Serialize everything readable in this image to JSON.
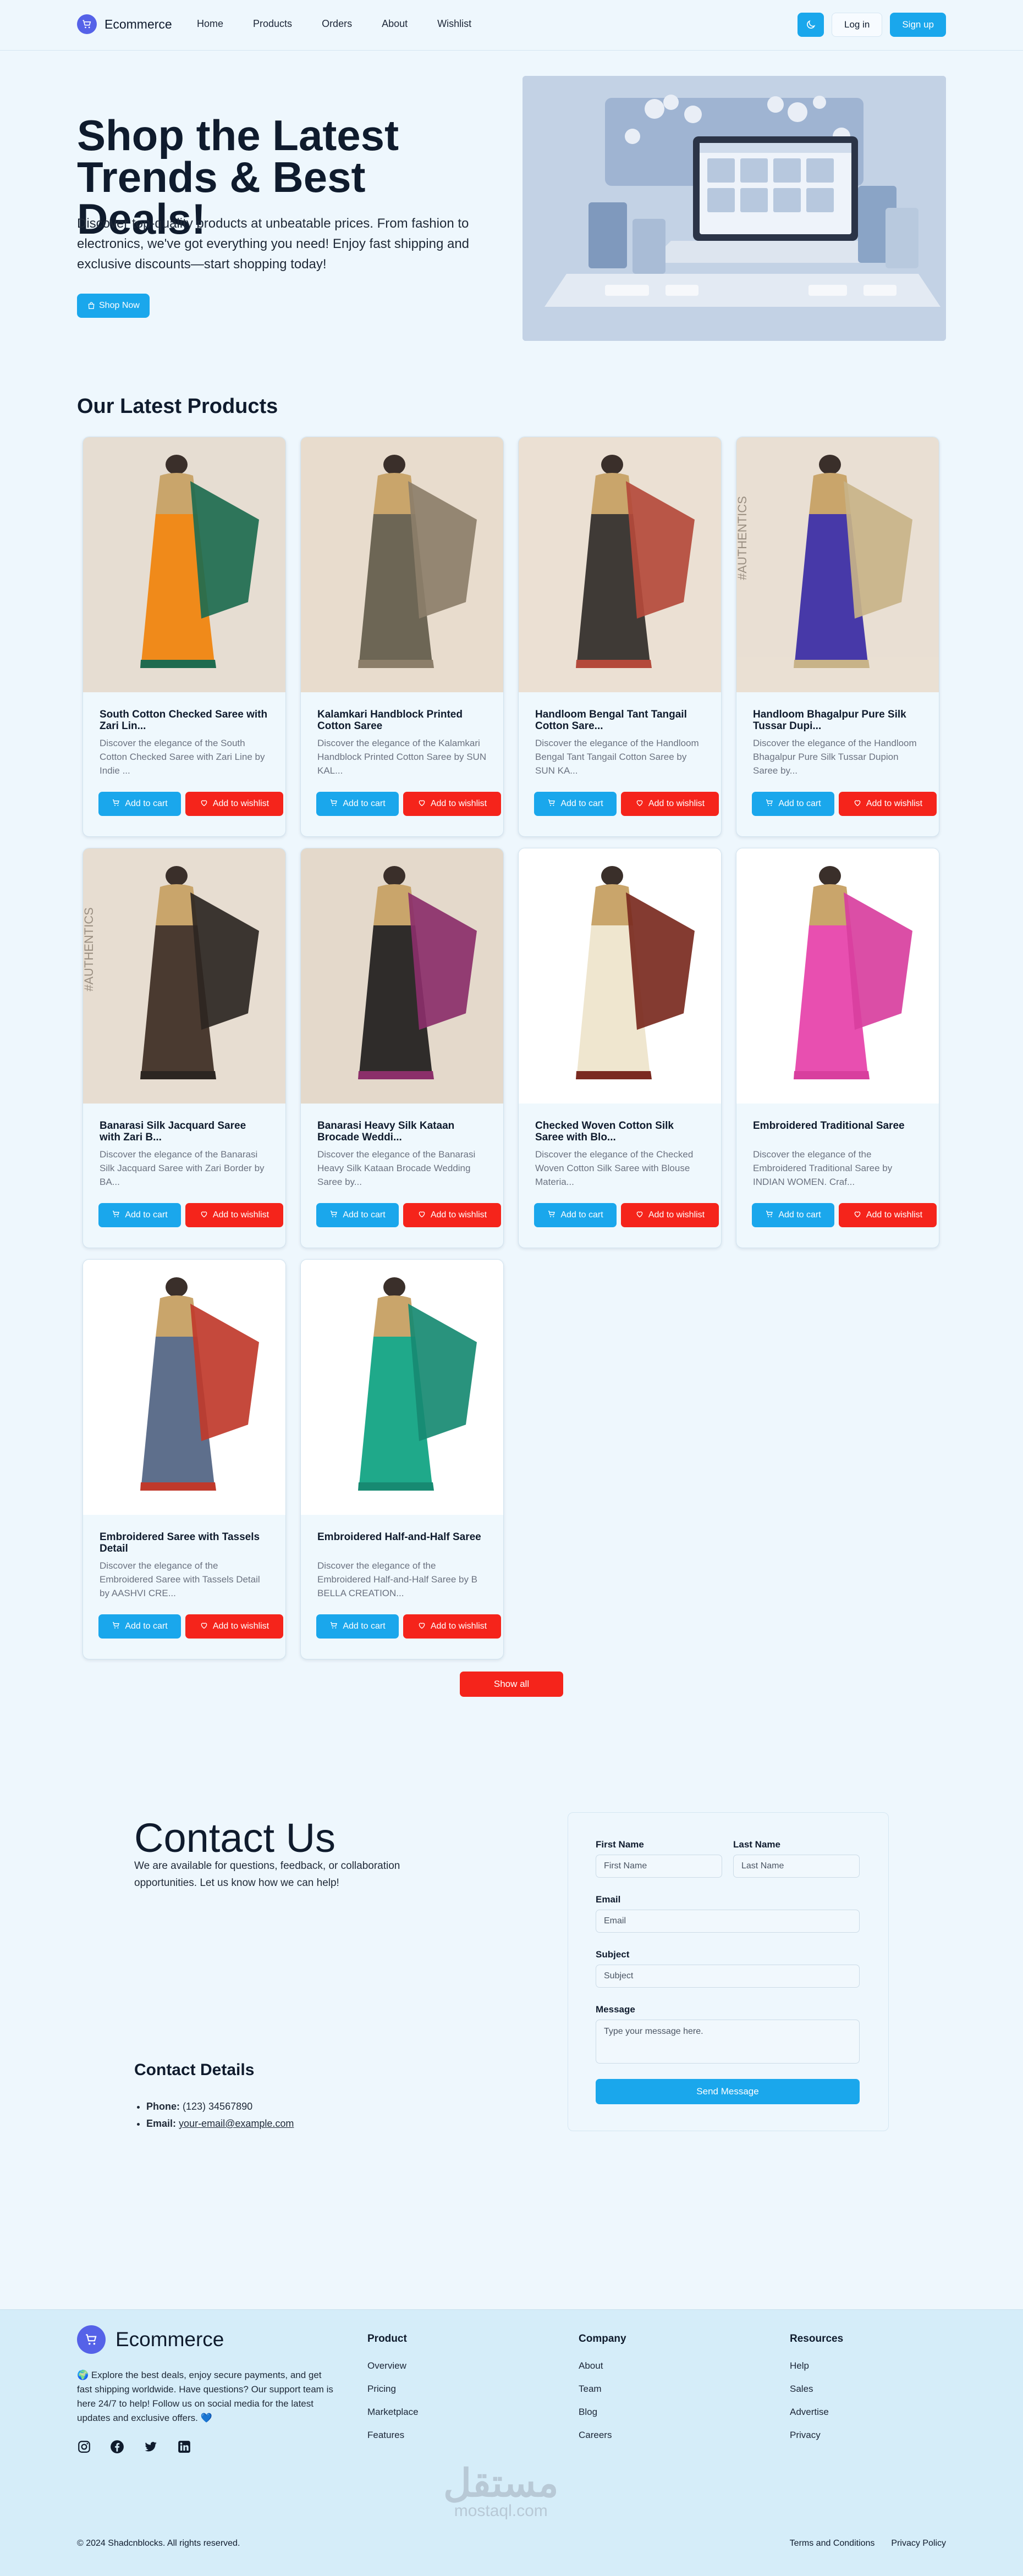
{
  "nav": {
    "brand": "Ecommerce",
    "links": [
      "Home",
      "Products",
      "Orders",
      "About",
      "Wishlist"
    ],
    "login": "Log in",
    "signup": "Sign up"
  },
  "hero": {
    "title": "Shop the Latest Trends & Best Deals!",
    "description": "Discover top-quality products at unbeatable prices. From fashion to electronics, we've got everything you need! Enjoy fast shipping and exclusive discounts—start shopping today!",
    "cta": "Shop Now"
  },
  "products": {
    "title": "Our Latest Products",
    "add_to_cart": "Add to cart",
    "add_to_wishlist": "Add to wishlist",
    "show_all": "Show all",
    "items": [
      {
        "title": "South Cotton Checked Saree with Zari Lin...",
        "desc": "Discover the elegance of the South Cotton Checked Saree with Zari Line by Indie ...",
        "colors": {
          "bg": "#e6ddd2",
          "drape": "#f08a1a",
          "pallu": "#1e6b4f"
        },
        "watermark": ""
      },
      {
        "title": "Kalamkari Handblock Printed Cotton Saree",
        "desc": "Discover the elegance of the Kalamkari Handblock Printed Cotton Saree by SUN KAL...",
        "colors": {
          "bg": "#e8dccd",
          "drape": "#6d6655",
          "pallu": "#8c7e6a"
        },
        "watermark": ""
      },
      {
        "title": "Handloom Bengal Tant Tangail Cotton Sare...",
        "desc": "Discover the elegance of the Handloom Bengal Tant Tangail Cotton Saree by SUN KA...",
        "colors": {
          "bg": "#ebe0d3",
          "drape": "#3f3a36",
          "pallu": "#b44a3b"
        },
        "watermark": ""
      },
      {
        "title": "Handloom Bhagalpur Pure Silk Tussar Dupi...",
        "desc": "Discover the elegance of the Handloom Bhagalpur Pure Silk Tussar Dupion Saree by...",
        "colors": {
          "bg": "#e9dfd3",
          "drape": "#4739a8",
          "pallu": "#c8b388"
        },
        "watermark": "#AUTHENTICS"
      },
      {
        "title": "Banarasi Silk Jacquard Saree with Zari B...",
        "desc": "Discover the elegance of the Banarasi Silk Jacquard Saree with Zari Border by BA...",
        "colors": {
          "bg": "#e7ddd1",
          "drape": "#4a3a30",
          "pallu": "#2c2622"
        },
        "watermark": "#AUTHENTICS"
      },
      {
        "title": "Banarasi Heavy Silk Kataan Brocade Weddi...",
        "desc": "Discover the elegance of the Banarasi Heavy Silk Kataan Brocade Wedding Saree by...",
        "colors": {
          "bg": "#e4d9cb",
          "drape": "#2f2c2a",
          "pallu": "#8b2f6a"
        },
        "watermark": ""
      },
      {
        "title": "Checked Woven Cotton Silk Saree with Blo...",
        "desc": "Discover the elegance of the Checked Woven Cotton Silk Saree with Blouse Materia...",
        "colors": {
          "bg": "#ffffff",
          "drape": "#efe6cf",
          "pallu": "#7a2a20"
        },
        "watermark": ""
      },
      {
        "title": "Embroidered Traditional Saree",
        "desc": "Discover the elegance of the Embroidered Traditional Saree by INDIAN WOMEN. Craf...",
        "colors": {
          "bg": "#ffffff",
          "drape": "#e84fb0",
          "pallu": "#d83f9e"
        },
        "watermark": ""
      },
      {
        "title": "Embroidered Saree with Tassels Detail",
        "desc": "Discover the elegance of the Embroidered Saree with Tassels Detail by AASHVI CRE...",
        "colors": {
          "bg": "#ffffff",
          "drape": "#5e6f8c",
          "pallu": "#c0392b"
        },
        "watermark": ""
      },
      {
        "title": "Embroidered Half-and-Half Saree",
        "desc": "Discover the elegance of the Embroidered Half-and-Half Saree by B BELLA CREATION...",
        "colors": {
          "bg": "#ffffff",
          "drape": "#1fa98a",
          "pallu": "#178a72"
        },
        "watermark": ""
      }
    ]
  },
  "contact": {
    "title": "Contact Us",
    "description": "We are available for questions, feedback, or collaboration opportunities. Let us know how we can help!",
    "details_title": "Contact Details",
    "phone_label": "Phone:",
    "phone": "(123) 34567890",
    "email_label": "Email:",
    "email": "your-email@example.com",
    "form": {
      "first_name_label": "First Name",
      "first_name_placeholder": "First Name",
      "last_name_label": "Last Name",
      "last_name_placeholder": "Last Name",
      "email_label": "Email",
      "email_placeholder": "Email",
      "subject_label": "Subject",
      "subject_placeholder": "Subject",
      "message_label": "Message",
      "message_placeholder": "Type your message here.",
      "submit": "Send Message"
    }
  },
  "footer": {
    "brand": "Ecommerce",
    "about": "🌍 Explore the best deals, enjoy secure payments, and get fast shipping worldwide. Have questions? Our support team is here 24/7 to help! Follow us on social media for the latest updates and exclusive offers. 💙",
    "columns": [
      {
        "title": "Product",
        "links": [
          "Overview",
          "Pricing",
          "Marketplace",
          "Features"
        ]
      },
      {
        "title": "Company",
        "links": [
          "About",
          "Team",
          "Blog",
          "Careers"
        ]
      },
      {
        "title": "Resources",
        "links": [
          "Help",
          "Sales",
          "Advertise",
          "Privacy"
        ]
      }
    ],
    "socials": [
      "instagram-icon",
      "facebook-icon",
      "twitter-icon",
      "linkedin-icon"
    ],
    "watermark_ar": "مستقل",
    "watermark_en": "mostaql.com",
    "copyright": "© 2024 Shadcnblocks. All rights reserved.",
    "legal": [
      "Terms and Conditions",
      "Privacy Policy"
    ]
  },
  "colors": {
    "primary": "#1aa7ec",
    "danger": "#f5241b",
    "logo": "#5562e8",
    "background": "#eef7fd"
  }
}
